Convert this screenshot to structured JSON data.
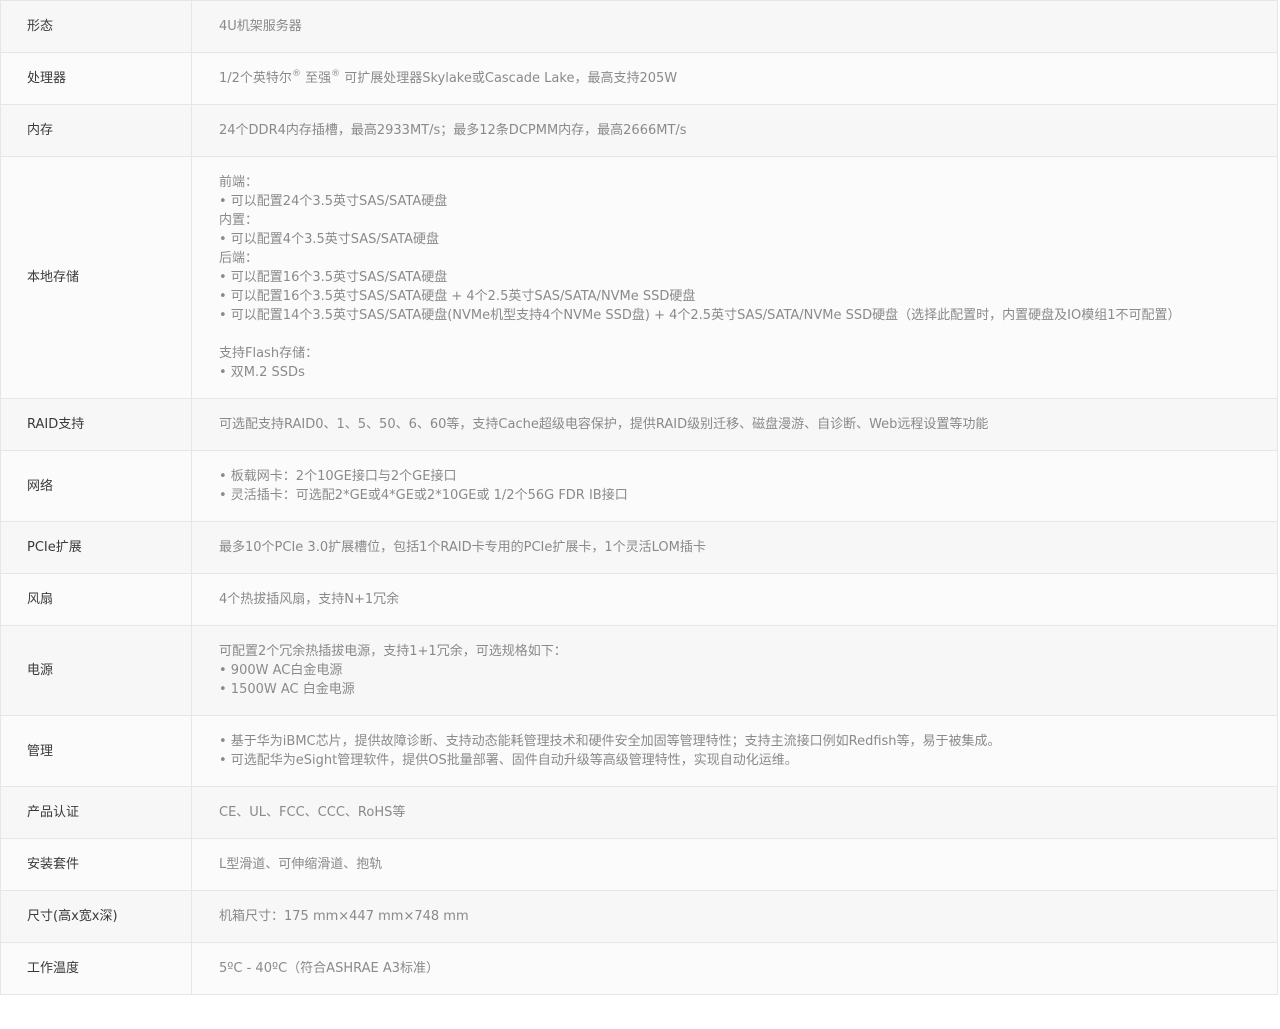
{
  "specs": [
    {
      "label": "形态",
      "lines": [
        "4U机架服务器"
      ]
    },
    {
      "label": "处理器",
      "lines": [
        "1/2个英特尔® 至强® 可扩展处理器Skylake或Cascade Lake，最高支持205W"
      ]
    },
    {
      "label": "内存",
      "lines": [
        "24个DDR4内存插槽，最高2933MT/s；最多12条DCPMM内存，最高2666MT/s"
      ]
    },
    {
      "label": "本地存储",
      "lines": [
        "前端：",
        "• 可以配置24个3.5英寸SAS/SATA硬盘",
        "内置：",
        "• 可以配置4个3.5英寸SAS/SATA硬盘",
        "后端：",
        "• 可以配置16个3.5英寸SAS/SATA硬盘",
        "• 可以配置16个3.5英寸SAS/SATA硬盘 + 4个2.5英寸SAS/SATA/NVMe SSD硬盘",
        "• 可以配置14个3.5英寸SAS/SATA硬盘(NVMe机型支持4个NVMe SSD盘) + 4个2.5英寸SAS/SATA/NVMe SSD硬盘（选择此配置时，内置硬盘及IO模组1不可配置）",
        "",
        "支持Flash存储：",
        "• 双M.2 SSDs"
      ]
    },
    {
      "label": "RAID支持",
      "lines": [
        "可选配支持RAID0、1、5、50、6、60等，支持Cache超级电容保护，提供RAID级别迁移、磁盘漫游、自诊断、Web远程设置等功能"
      ]
    },
    {
      "label": "网络",
      "lines": [
        "• 板载网卡：2个10GE接口与2个GE接口",
        "• 灵活插卡：可选配2*GE或4*GE或2*10GE或 1/2个56G FDR IB接口"
      ]
    },
    {
      "label": "PCIe扩展",
      "lines": [
        "最多10个PCIe 3.0扩展槽位，包括1个RAID卡专用的PCIe扩展卡，1个灵活LOM插卡"
      ]
    },
    {
      "label": "风扇",
      "lines": [
        "4个热拔插风扇，支持N+1冗余"
      ]
    },
    {
      "label": "电源",
      "lines": [
        "可配置2个冗余热插拔电源，支持1+1冗余，可选规格如下：",
        "• 900W AC白金电源",
        "• 1500W AC 白金电源"
      ]
    },
    {
      "label": "管理",
      "lines": [
        "• 基于华为iBMC芯片，提供故障诊断、支持动态能耗管理技术和硬件安全加固等管理特性；支持主流接口例如Redfish等，易于被集成。",
        "• 可选配华为eSight管理软件，提供OS批量部署、固件自动升级等高级管理特性，实现自动化运维。"
      ]
    },
    {
      "label": "产品认证",
      "lines": [
        "CE、UL、FCC、CCC、RoHS等"
      ]
    },
    {
      "label": "安装套件",
      "lines": [
        "L型滑道、可伸缩滑道、抱轨"
      ]
    },
    {
      "label": "尺寸(高x宽x深)",
      "lines": [
        "机箱尺寸：175 mm×447 mm×748 mm"
      ]
    },
    {
      "label": "工作温度",
      "lines": [
        "5ºC - 40ºC（符合ASHRAE A3标准）"
      ]
    }
  ]
}
